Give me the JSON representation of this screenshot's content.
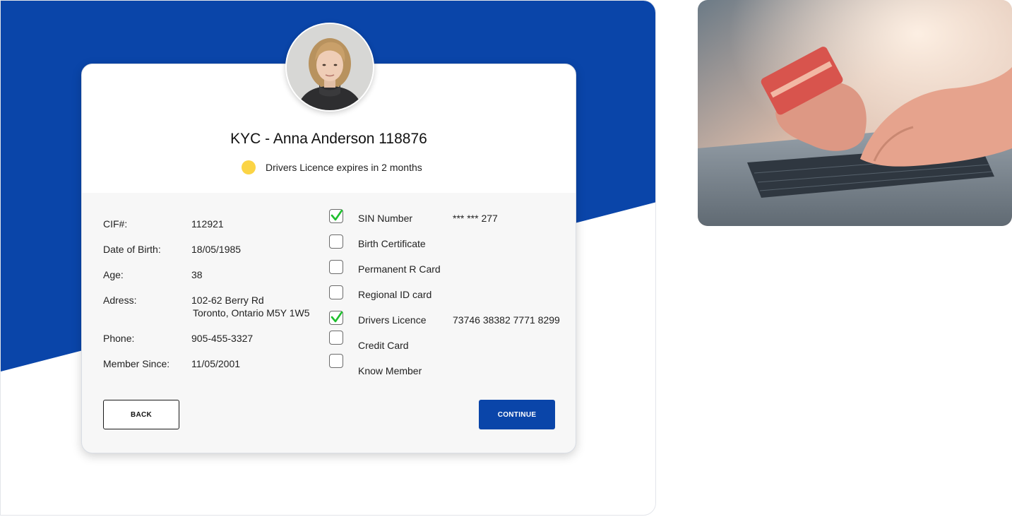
{
  "profile": {
    "title": "KYC - Anna Anderson 118876",
    "alert_text": "Drivers Licence expires in 2 months"
  },
  "info": [
    {
      "label": "CIF#:",
      "value": "112921"
    },
    {
      "label": "Date of Birth:",
      "value": "18/05/1985"
    },
    {
      "label": "Age:",
      "value": "38"
    },
    {
      "label": "Adress:",
      "value_line1": "102-62 Berry Rd",
      "value_line2": "Toronto, Ontario M5Y 1W5"
    },
    {
      "label": "Phone:",
      "value": "905-455-3327"
    },
    {
      "label": "Member Since:",
      "value": "11/05/2001"
    }
  ],
  "documents": [
    {
      "label": "SIN Number",
      "value": "*** *** 277",
      "checked": true
    },
    {
      "label": "Birth Certificate",
      "value": "",
      "checked": false
    },
    {
      "label": "Permanent R Card",
      "value": "",
      "checked": false
    },
    {
      "label": "Regional ID card",
      "value": "",
      "checked": false
    },
    {
      "label": "Drivers Licence",
      "value": "73746 38382 7771 8299",
      "checked": true
    },
    {
      "label": "Credit Card",
      "value": "",
      "checked": false
    },
    {
      "label": "Know Member",
      "value": "",
      "checked": false
    }
  ],
  "buttons": {
    "back": "BACK",
    "continue": "CONTINUE"
  },
  "icons": {
    "alert_dot": "status-dot-icon",
    "check": "checkmark-icon"
  },
  "colors": {
    "brand_blue": "#0a45a9",
    "alert_yellow": "#fbd445",
    "check_green": "#1fbf2e"
  }
}
